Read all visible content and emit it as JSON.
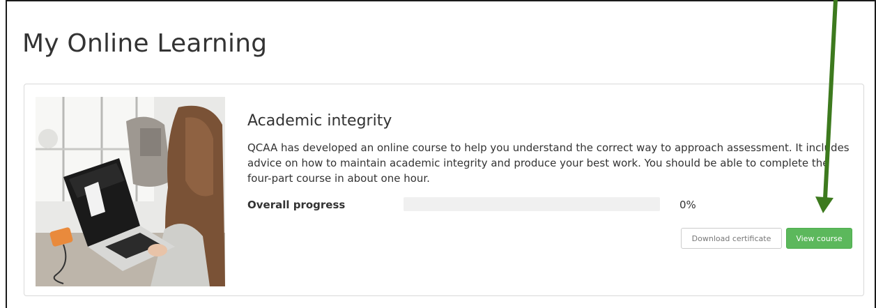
{
  "page": {
    "title": "My Online Learning"
  },
  "course": {
    "title": "Academic integrity",
    "description": "QCAA has developed an online course to help you understand the correct way to approach assessment. It includes advice on how to maintain academic integrity and produce your best work. You should be able to complete the four-part course in about one hour.",
    "progress_label": "Overall progress",
    "progress_value_text": "0%",
    "progress_fraction": 0,
    "image_icon": "course-photo-laptop-icon"
  },
  "buttons": {
    "download_label": "Download certificate",
    "view_label": "View course"
  },
  "colors": {
    "accent_green": "#5cb85c",
    "annotation_arrow": "#3d7a1e",
    "progress_track": "#f0f0f0"
  },
  "annotation": {
    "icon": "down-arrow-icon"
  }
}
